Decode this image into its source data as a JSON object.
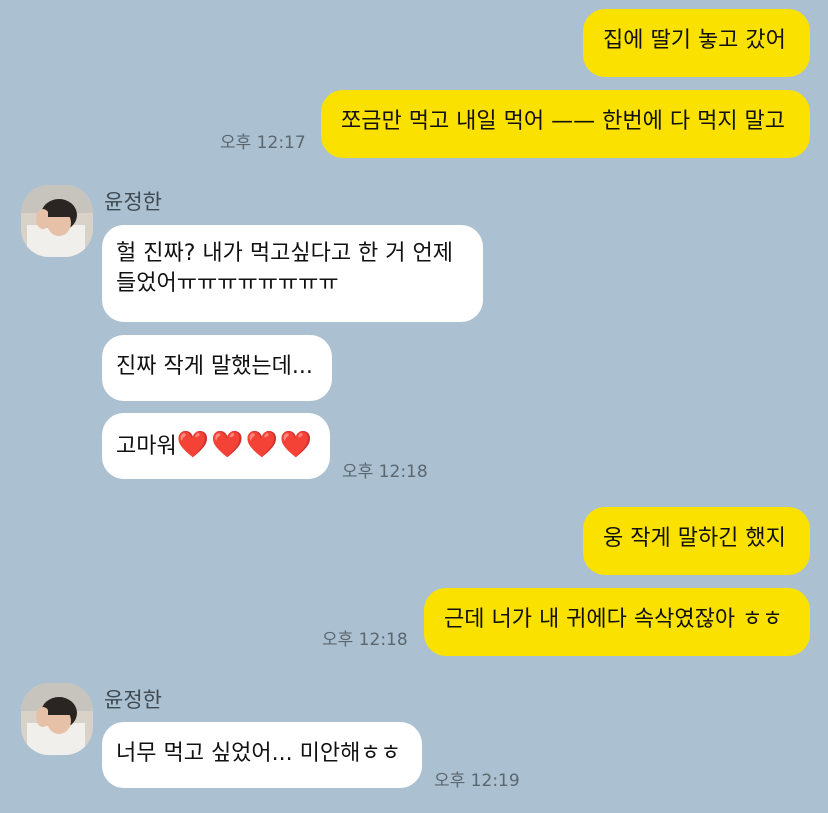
{
  "messages": {
    "m1": "집에 딸기 놓고 갔어",
    "m2": "쪼금만 먹고 내일 먹어 —— 한번에 다 먹지 말고",
    "m2_time": "오후 12:17",
    "sender1": "윤정한",
    "m3_line1": "헐 진짜? 내가 먹고싶다고 한 거 언제",
    "m3_line2": "들었어ㅠㅠㅠㅠㅠㅠㅠㅠ",
    "m4": "진짜 작게 말했는데...",
    "m5_text": "고마워",
    "m5_hearts": "❤️❤️❤️❤️",
    "m5_time": "오후 12:18",
    "m6": "웅 작게 말하긴 했지",
    "m7": "근데 너가 내 귀에다 속삭였잖아 ㅎㅎ",
    "m7_time": "오후 12:18",
    "sender2": "윤정한",
    "m8": "너무 먹고 싶었어... 미안해ㅎㅎ",
    "m8_time": "오후 12:19"
  },
  "colors": {
    "background": "#abc1d1",
    "outgoing_bubble": "#fae100",
    "incoming_bubble": "#ffffff",
    "heart": "#e5181b"
  },
  "icons": {
    "avatar": "profile-photo"
  }
}
